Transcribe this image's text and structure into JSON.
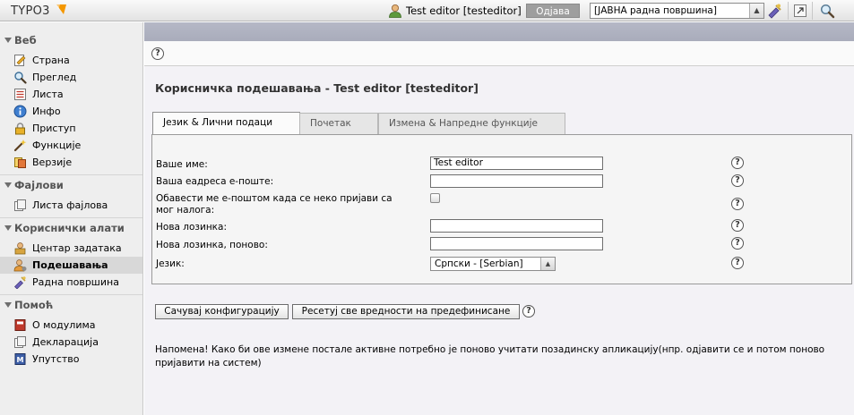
{
  "topbar": {
    "logo_text": "TYPO3",
    "user_label": "Test editor [testeditor]",
    "logout_label": "Одјава",
    "workspace_value": "[ЈАВНА радна површина]"
  },
  "nav": {
    "groups": [
      {
        "title": "Веб",
        "items": [
          {
            "label": "Страна",
            "icon": "page-icon"
          },
          {
            "label": "Преглед",
            "icon": "magnifier-icon"
          },
          {
            "label": "Листа",
            "icon": "list-icon"
          },
          {
            "label": "Инфо",
            "icon": "info-icon"
          },
          {
            "label": "Приступ",
            "icon": "lock-icon"
          },
          {
            "label": "Функције",
            "icon": "wand-icon"
          },
          {
            "label": "Верзије",
            "icon": "versions-icon"
          }
        ]
      },
      {
        "title": "Фајлови",
        "items": [
          {
            "label": "Листа фајлова",
            "icon": "folder-icon"
          }
        ]
      },
      {
        "title": "Кориснички алати",
        "items": [
          {
            "label": "Центар задатака",
            "icon": "taskcenter-icon"
          },
          {
            "label": "Подешавања",
            "icon": "user-settings-icon",
            "active": true
          },
          {
            "label": "Радна површина",
            "icon": "workspace-icon"
          }
        ]
      },
      {
        "title": "Помоћ",
        "items": [
          {
            "label": "О модулима",
            "icon": "book-icon"
          },
          {
            "label": "Декларација",
            "icon": "document-icon"
          },
          {
            "label": "Упутство",
            "icon": "manual-icon"
          }
        ]
      }
    ]
  },
  "main": {
    "help_symbol": "?",
    "title": "Корисничка подешавања - Test editor [testeditor]",
    "tabs": [
      {
        "label": "Језик & Лични подаци",
        "active": true
      },
      {
        "label": "Почетак"
      },
      {
        "label": "Измена & Напредне функције"
      }
    ],
    "form": {
      "name_label": "Ваше име:",
      "name_value": "Test editor",
      "email_label": "Ваша еадреса е-поште:",
      "email_value": "",
      "notify_label": "Обавести ме е-поштом када се неко пријави са мог налога:",
      "notify_checked": false,
      "password_label": "Нова лозинка:",
      "password_value": "",
      "password2_label": "Нова лозинка, поново:",
      "password2_value": "",
      "language_label": "Језик:",
      "language_value": "Српски - [Serbian]"
    },
    "save_label": "Сачувај конфигурацију",
    "reset_label": "Ресетуј све вредности на предефинисане",
    "note": "Напомена! Како би ове измене постале активне потребно је поново учитати позадинску апликацију(нпр. одјавити се и потом поново пријавити на систем)"
  }
}
